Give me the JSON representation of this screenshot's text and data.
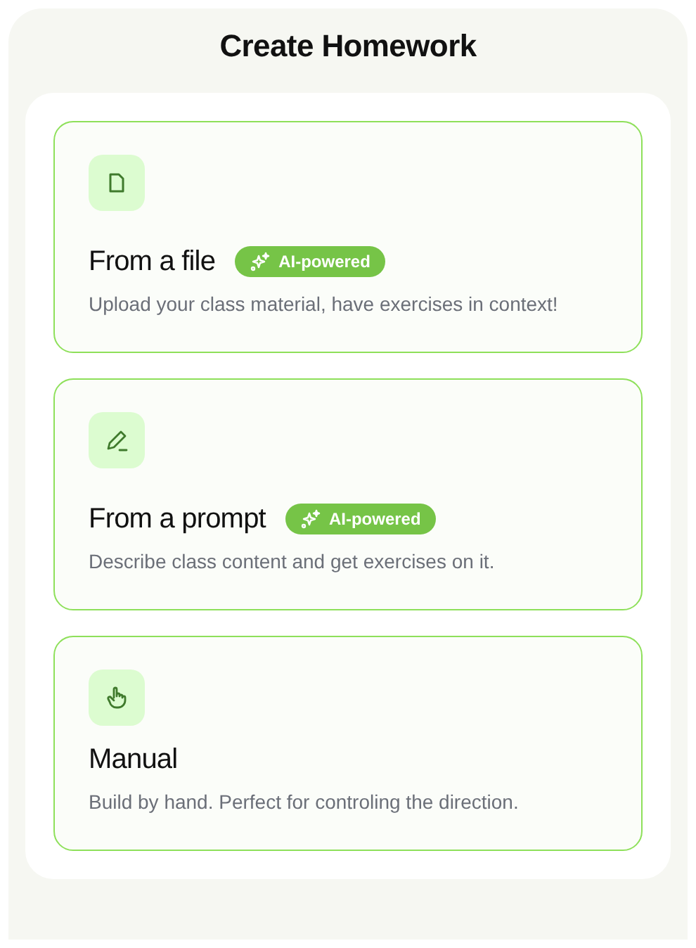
{
  "title": "Create Homework",
  "options": [
    {
      "kind": "file",
      "title": "From a file",
      "badge": "AI-powered",
      "description": "Upload your class material, have exercises in context!"
    },
    {
      "kind": "prompt",
      "title": "From a prompt",
      "badge": "AI-powered",
      "description": "Describe class content and get exercises on it."
    },
    {
      "kind": "manual",
      "title": "Manual",
      "description": "Build by hand. Perfect for controling the direction."
    }
  ]
}
